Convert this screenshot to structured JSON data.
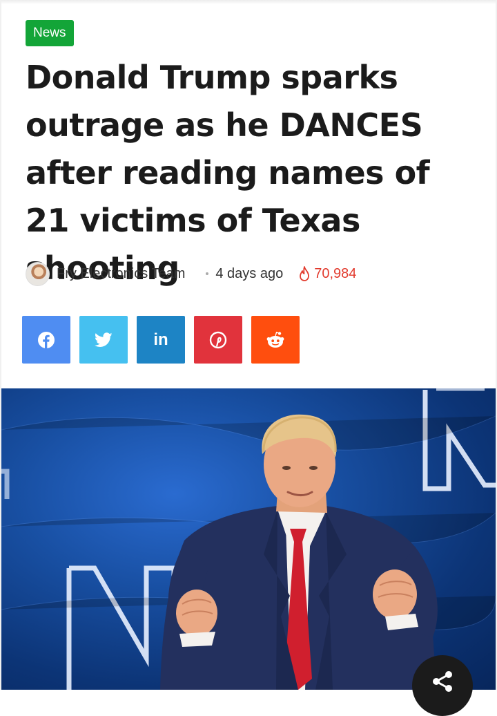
{
  "article": {
    "category": "News",
    "title": "Donald Trump sparks outrage as he DANCES after reading names of 21 victims of Texas shooting",
    "author": "Fry Electronics Team",
    "time_ago": "4 days ago",
    "view_count": "70,984"
  },
  "share_buttons": [
    {
      "network": "facebook",
      "icon": "facebook-icon",
      "color": "#4f8df2"
    },
    {
      "network": "twitter",
      "icon": "twitter-icon",
      "color": "#45c0f0"
    },
    {
      "network": "linkedin",
      "icon": "linkedin-icon",
      "label": "in",
      "color": "#1d84c5"
    },
    {
      "network": "pinterest",
      "icon": "pinterest-icon",
      "color": "#e1333c"
    },
    {
      "network": "reddit",
      "icon": "reddit-icon",
      "color": "#ff4e0e"
    }
  ],
  "colors": {
    "badge": "#13a538",
    "title_text": "#1b1b1b",
    "views": "#e23b2e"
  },
  "icons": {
    "views": "fire-icon",
    "floating_share": "share-icon"
  }
}
